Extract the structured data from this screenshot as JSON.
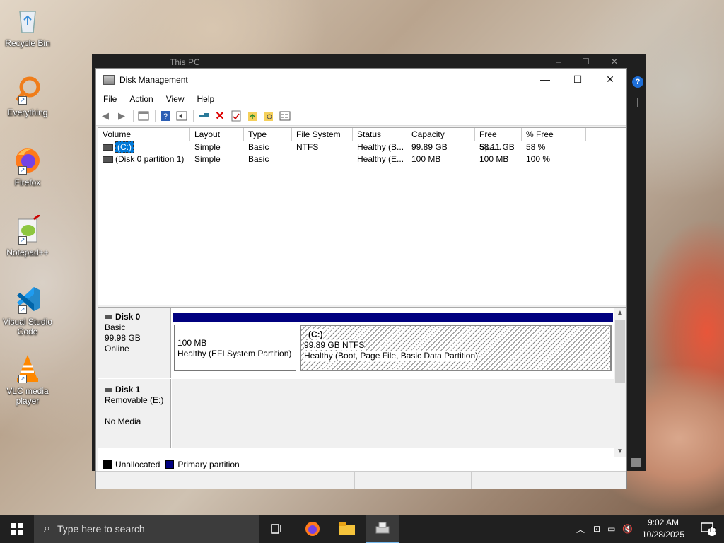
{
  "desktop": {
    "icons": [
      {
        "label": "Recycle Bin",
        "icon": "recycle-bin-icon"
      },
      {
        "label": "Everything",
        "icon": "everything-search-icon"
      },
      {
        "label": "Firefox",
        "icon": "firefox-icon"
      },
      {
        "label": "Notepad++",
        "icon": "notepad-plus-plus-icon"
      },
      {
        "label": "Visual Studio Code",
        "icon": "vscode-icon"
      },
      {
        "label": "VLC media player",
        "icon": "vlc-icon"
      }
    ]
  },
  "background_window": {
    "title": "This PC"
  },
  "window": {
    "title": "Disk Management",
    "menu": [
      "File",
      "Action",
      "View",
      "Help"
    ],
    "toolbar": [
      "back-icon",
      "forward-icon",
      "properties-icon",
      "help-icon",
      "console-icon",
      "connect-icon",
      "delete-icon",
      "check-icon",
      "new-folder-icon",
      "search-folder-icon",
      "view-icon"
    ],
    "columns": [
      "Volume",
      "Layout",
      "Type",
      "File System",
      "Status",
      "Capacity",
      "Free Spa...",
      "% Free"
    ],
    "rows": [
      {
        "volume": "(C:)",
        "layout": "Simple",
        "type": "Basic",
        "fs": "NTFS",
        "status": "Healthy (B...",
        "capacity": "99.89 GB",
        "free": "58.11 GB",
        "pct": "58 %"
      },
      {
        "volume": "(Disk 0 partition 1)",
        "layout": "Simple",
        "type": "Basic",
        "fs": "",
        "status": "Healthy (E...",
        "capacity": "100 MB",
        "free": "100 MB",
        "pct": "100 %"
      }
    ],
    "disks": [
      {
        "name": "Disk 0",
        "type": "Basic",
        "size": "99.98 GB",
        "state": "Online",
        "partitions": [
          {
            "label": "",
            "size": "100 MB",
            "status": "Healthy (EFI System Partition)"
          },
          {
            "label": "(C:)",
            "size": "99.89 GB NTFS",
            "status": "Healthy (Boot, Page File, Basic Data Partition)"
          }
        ]
      },
      {
        "name": "Disk 1",
        "type": "Removable (E:)",
        "size": "",
        "state": "No Media"
      }
    ],
    "legend": [
      {
        "label": "Unallocated",
        "color": "#000000"
      },
      {
        "label": "Primary partition",
        "color": "#00007f"
      }
    ]
  },
  "taskbar": {
    "search_placeholder": "Type here to search",
    "apps": [
      "task-view-icon",
      "firefox-icon",
      "file-explorer-icon",
      "disk-management-icon"
    ],
    "time": "9:02 AM",
    "date": "10/28/2025",
    "notifications": "10"
  }
}
